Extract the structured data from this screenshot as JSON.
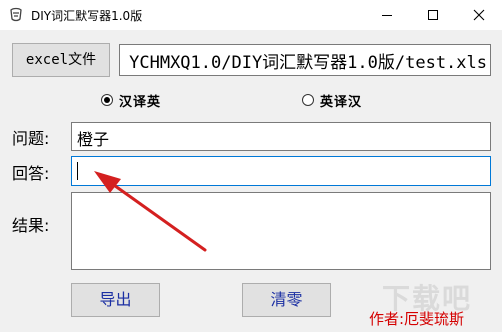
{
  "window": {
    "title": "DIY词汇默写器1.0版",
    "icon": "app-icon"
  },
  "toolbar": {
    "excel_button": "excel文件",
    "file_path": "YCHMXQ1.0/DIY词汇默写器1.0版/test.xls"
  },
  "mode": {
    "options": [
      {
        "label": "汉译英",
        "selected": true
      },
      {
        "label": "英译汉",
        "selected": false
      }
    ]
  },
  "question": {
    "label": "问题:",
    "value": "橙子"
  },
  "answer": {
    "label": "回答:",
    "value": ""
  },
  "result": {
    "label": "结果:",
    "value": ""
  },
  "buttons": {
    "export": "导出",
    "clear": "清零"
  },
  "annotation": {
    "author": "作者:厄斐琉斯",
    "arrow_color": "#d42020"
  },
  "watermark": {
    "text": "下载吧"
  },
  "colors": {
    "focus_border": "#0078d7",
    "button_text": "#1b2fa3",
    "author_text": "#d40000"
  }
}
